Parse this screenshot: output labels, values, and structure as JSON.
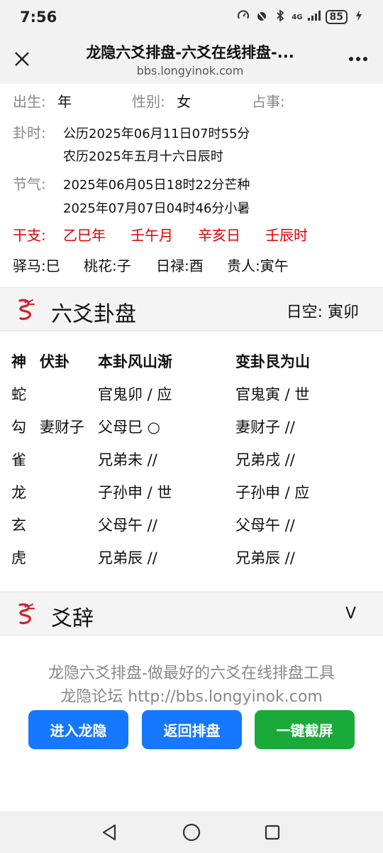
{
  "status_bar": {
    "time": "7:56",
    "network": "4G",
    "battery": "85",
    "icons": [
      "speedometer-icon",
      "alarm-icon",
      "bluetooth-icon",
      "signal-icon",
      "battery-icon",
      "charging-icon"
    ]
  },
  "browser": {
    "title": "龙隐六爻排盘-六爻在线排盘-...",
    "url": "bbs.longyinok.com",
    "close_icon": "close-icon",
    "more_icon": "more-icon"
  },
  "info": {
    "birth_label": "出生:",
    "birth_value": "年",
    "gender_label": "性别:",
    "gender_value": "女",
    "matter_label": "占事:",
    "time_label": "卦时:",
    "time_solar": "公历2025年06月11日07时55分",
    "time_lunar": "农历2025年五月十六日辰时",
    "jieqi_label": "节气:",
    "jieqi_1": "2025年06月05日18时22分芒种",
    "jieqi_2": "2025年07月07日04时46分小暑",
    "ganzhi_label": "干支:",
    "ganzhi": [
      "乙巳年",
      "壬午月",
      "辛亥日",
      "壬辰时"
    ],
    "shensha": [
      "驿马:巳",
      "桃花:子",
      "日禄:酉",
      "贵人:寅午"
    ]
  },
  "hexagram_section": {
    "title": "六爻卦盘",
    "rikong": "日空:  寅卯",
    "headers": [
      "神",
      "伏卦",
      "本卦风山渐",
      "变卦艮为山"
    ],
    "rows": [
      [
        "蛇",
        "",
        "官鬼卯  / 应",
        "官鬼寅  / 世"
      ],
      [
        "勾",
        "妻财子",
        "父母巳 ○",
        "妻财子 //"
      ],
      [
        "雀",
        "",
        "兄弟未 //",
        "兄弟戌 //"
      ],
      [
        "龙",
        "",
        "子孙申  / 世",
        "子孙申  / 应"
      ],
      [
        "玄",
        "",
        "父母午 //",
        "父母午 //"
      ],
      [
        "虎",
        "",
        "兄弟辰 //",
        "兄弟辰 //"
      ]
    ]
  },
  "yaoci_section": {
    "title": "爻辞",
    "expand": "V"
  },
  "footer": {
    "line1": "龙隐六爻排盘-做最好的六爻在线排盘工具",
    "line2": "龙隐论坛 http://bbs.longyinok.com",
    "btn_enter": "进入龙隐",
    "btn_back": "返回排盘",
    "btn_screenshot": "一键截屏"
  },
  "colors": {
    "red": "#e00000",
    "blue_button": "#1677ff",
    "green_button": "#1aaa3a"
  }
}
